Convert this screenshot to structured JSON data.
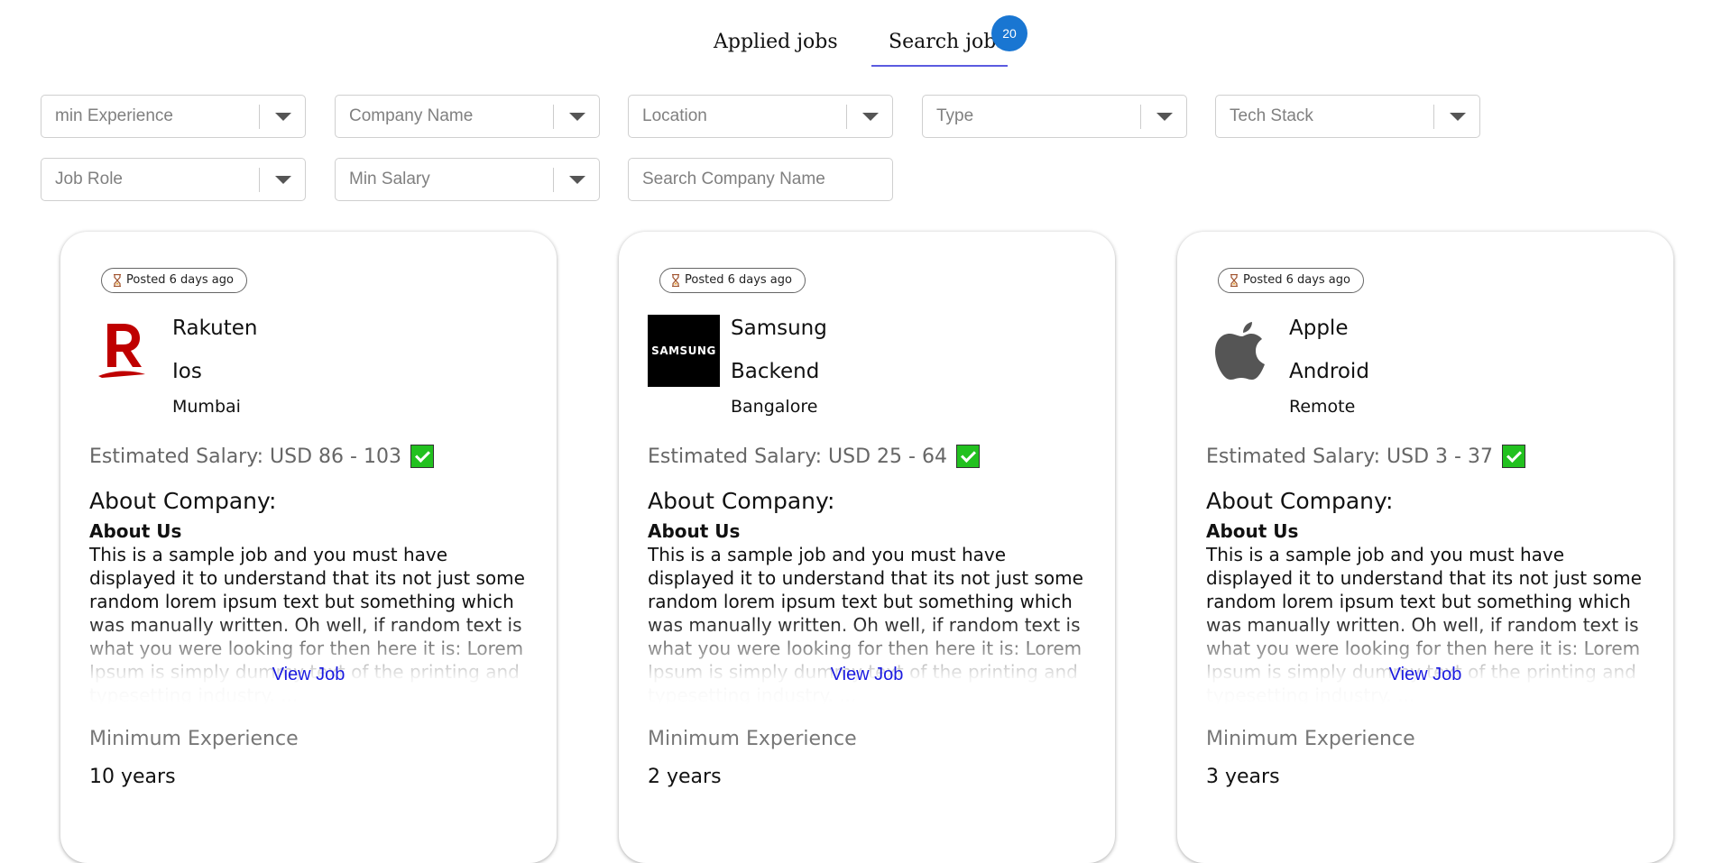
{
  "tabs": {
    "applied_label": "Applied jobs",
    "search_label": "Search jobs",
    "badge_count": "20"
  },
  "filters": {
    "min_experience": "min Experience",
    "company_name": "Company Name",
    "location": "Location",
    "type": "Type",
    "tech_stack": "Tech Stack",
    "job_role": "Job Role",
    "min_salary": "Min Salary",
    "search_company_placeholder": "Search Company Name"
  },
  "cards": [
    {
      "posted": "Posted 6 days ago",
      "company": "Rakuten",
      "role": "Ios",
      "location": "Mumbai",
      "salary": "Estimated Salary: USD 86 - 103",
      "about_title": "About Company:",
      "about_us": "About Us",
      "description": "This is a sample job and you must have displayed it to understand that its not just some random lorem ipsum text but something which was manually written. Oh well, if random text is what you were looking for then here it is: Lorem Ipsum is simply dummy text of the printing and typesetting industry. ...",
      "view_job": "View Job",
      "min_exp_label": "Minimum Experience",
      "min_exp_value": "10 years",
      "logo": "rakuten-logo"
    },
    {
      "posted": "Posted 6 days ago",
      "company": "Samsung",
      "role": "Backend",
      "location": "Bangalore",
      "salary": "Estimated Salary: USD 25 - 64",
      "about_title": "About Company:",
      "about_us": "About Us",
      "description": "This is a sample job and you must have displayed it to understand that its not just some random lorem ipsum text but something which was manually written. Oh well, if random text is what you were looking for then here it is: Lorem Ipsum is simply dummy text of the printing and typesetting industry. ...",
      "view_job": "View Job",
      "min_exp_label": "Minimum Experience",
      "min_exp_value": "2 years",
      "logo": "samsung-logo",
      "logo_text": "SAMSUNG"
    },
    {
      "posted": "Posted 6 days ago",
      "company": "Apple",
      "role": "Android",
      "location": "Remote",
      "salary": "Estimated Salary: USD 3 - 37",
      "about_title": "About Company:",
      "about_us": "About Us",
      "description": "This is a sample job and you must have displayed it to understand that its not just some random lorem ipsum text but something which was manually written. Oh well, if random text is what you were looking for then here it is: Lorem Ipsum is simply dummy text of the printing and typesetting industry. ...",
      "view_job": "View Job",
      "min_exp_label": "Minimum Experience",
      "min_exp_value": "3 years",
      "logo": "apple-logo"
    }
  ],
  "colors": {
    "badge": "#1976d2",
    "tab_underline": "#5b5be0",
    "view_job_link": "#1a1ae0",
    "check_green": "#22c11f",
    "rakuten_red": "#bf0000"
  }
}
